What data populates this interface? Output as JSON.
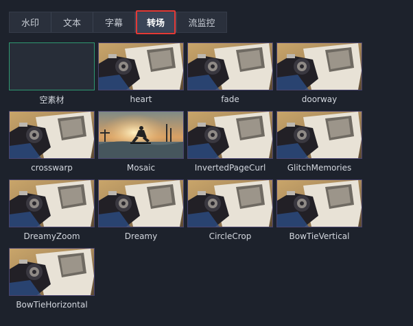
{
  "tabs": [
    {
      "label": "水印",
      "active": false
    },
    {
      "label": "文本",
      "active": false
    },
    {
      "label": "字幕",
      "active": false
    },
    {
      "label": "转场",
      "active": true
    },
    {
      "label": "流监控",
      "active": false
    }
  ],
  "transitions": [
    {
      "label": "空素材",
      "thumb": "empty"
    },
    {
      "label": "heart",
      "thumb": "camera"
    },
    {
      "label": "fade",
      "thumb": "camera"
    },
    {
      "label": "doorway",
      "thumb": "camera"
    },
    {
      "label": "crosswarp",
      "thumb": "camera"
    },
    {
      "label": "Mosaic",
      "thumb": "skate"
    },
    {
      "label": "InvertedPageCurl",
      "thumb": "camera"
    },
    {
      "label": "GlitchMemories",
      "thumb": "camera"
    },
    {
      "label": "DreamyZoom",
      "thumb": "camera"
    },
    {
      "label": "Dreamy",
      "thumb": "camera"
    },
    {
      "label": "CircleCrop",
      "thumb": "camera"
    },
    {
      "label": "BowTieVertical",
      "thumb": "camera"
    },
    {
      "label": "BowTieHorizontal",
      "thumb": "camera"
    }
  ],
  "colors": {
    "background": "#1d222c",
    "active_tab_outline": "#e53935",
    "empty_thumb_border": "#2f9a72"
  }
}
